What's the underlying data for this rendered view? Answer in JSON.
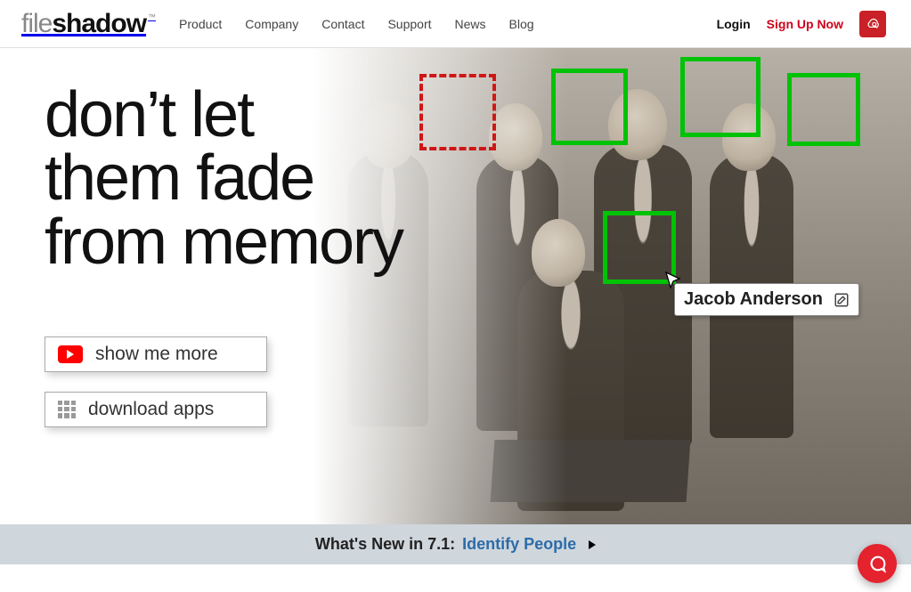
{
  "header": {
    "logo": {
      "part1": "file",
      "part2": "shadow",
      "tm": "™"
    },
    "nav": [
      "Product",
      "Company",
      "Contact",
      "Support",
      "News",
      "Blog"
    ],
    "login": "Login",
    "signup": "Sign Up Now"
  },
  "hero": {
    "headline_l1": "don’t let",
    "headline_l2": "them fade",
    "headline_l3": "from memory",
    "cta_showme": "show me more",
    "cta_download": "download apps",
    "nametag": "Jacob Anderson"
  },
  "news": {
    "prefix": "What's New in 7.1:",
    "link": "Identify People"
  }
}
